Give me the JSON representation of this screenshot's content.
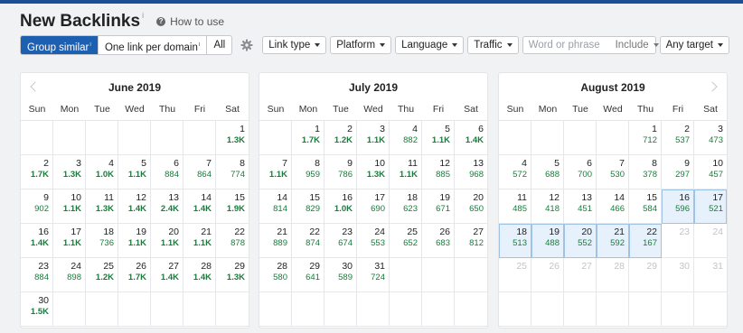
{
  "header": {
    "title": "New Backlinks",
    "title_sup": "i",
    "help_label": "How to use",
    "help_icon": "question-circle-icon"
  },
  "toolbar": {
    "group_similar": "Group similar",
    "one_link": "One link per domain",
    "all": "All",
    "settings_icon": "gear-icon",
    "link_type": "Link type",
    "platform": "Platform",
    "language": "Language",
    "traffic": "Traffic",
    "search_placeholder": "Word or phrase",
    "include": "Include",
    "any_target": "Any target"
  },
  "weekdays": [
    "Sun",
    "Mon",
    "Tue",
    "Wed",
    "Thu",
    "Fri",
    "Sat"
  ],
  "colors": {
    "accent": "#1d5fb0",
    "value_green": "#1c7a3c",
    "selected_bg": "#e7f1fb"
  },
  "calendars": [
    {
      "title": "June 2019",
      "cells": [
        {
          "d": "",
          "v": ""
        },
        {
          "d": "",
          "v": ""
        },
        {
          "d": "",
          "v": ""
        },
        {
          "d": "",
          "v": ""
        },
        {
          "d": "",
          "v": ""
        },
        {
          "d": "",
          "v": ""
        },
        {
          "d": "1",
          "v": "1.3K"
        },
        {
          "d": "2",
          "v": "1.7K"
        },
        {
          "d": "3",
          "v": "1.3K"
        },
        {
          "d": "4",
          "v": "1.0K"
        },
        {
          "d": "5",
          "v": "1.1K"
        },
        {
          "d": "6",
          "v": "884"
        },
        {
          "d": "7",
          "v": "864"
        },
        {
          "d": "8",
          "v": "774"
        },
        {
          "d": "9",
          "v": "902"
        },
        {
          "d": "10",
          "v": "1.1K"
        },
        {
          "d": "11",
          "v": "1.3K"
        },
        {
          "d": "12",
          "v": "1.4K"
        },
        {
          "d": "13",
          "v": "2.4K"
        },
        {
          "d": "14",
          "v": "1.4K"
        },
        {
          "d": "15",
          "v": "1.9K"
        },
        {
          "d": "16",
          "v": "1.4K"
        },
        {
          "d": "17",
          "v": "1.1K"
        },
        {
          "d": "18",
          "v": "736"
        },
        {
          "d": "19",
          "v": "1.1K"
        },
        {
          "d": "20",
          "v": "1.1K"
        },
        {
          "d": "21",
          "v": "1.1K"
        },
        {
          "d": "22",
          "v": "878"
        },
        {
          "d": "23",
          "v": "884"
        },
        {
          "d": "24",
          "v": "898"
        },
        {
          "d": "25",
          "v": "1.2K"
        },
        {
          "d": "26",
          "v": "1.7K"
        },
        {
          "d": "27",
          "v": "1.4K"
        },
        {
          "d": "28",
          "v": "1.4K"
        },
        {
          "d": "29",
          "v": "1.3K"
        },
        {
          "d": "30",
          "v": "1.5K"
        },
        {
          "d": "",
          "v": ""
        },
        {
          "d": "",
          "v": ""
        },
        {
          "d": "",
          "v": ""
        },
        {
          "d": "",
          "v": ""
        },
        {
          "d": "",
          "v": ""
        },
        {
          "d": "",
          "v": ""
        }
      ]
    },
    {
      "title": "July 2019",
      "cells": [
        {
          "d": "",
          "v": ""
        },
        {
          "d": "1",
          "v": "1.7K"
        },
        {
          "d": "2",
          "v": "1.2K"
        },
        {
          "d": "3",
          "v": "1.1K"
        },
        {
          "d": "4",
          "v": "882"
        },
        {
          "d": "5",
          "v": "1.1K"
        },
        {
          "d": "6",
          "v": "1.4K"
        },
        {
          "d": "7",
          "v": "1.1K"
        },
        {
          "d": "8",
          "v": "959"
        },
        {
          "d": "9",
          "v": "786"
        },
        {
          "d": "10",
          "v": "1.3K"
        },
        {
          "d": "11",
          "v": "1.1K"
        },
        {
          "d": "12",
          "v": "885"
        },
        {
          "d": "13",
          "v": "968"
        },
        {
          "d": "14",
          "v": "814"
        },
        {
          "d": "15",
          "v": "829"
        },
        {
          "d": "16",
          "v": "1.0K"
        },
        {
          "d": "17",
          "v": "690"
        },
        {
          "d": "18",
          "v": "623"
        },
        {
          "d": "19",
          "v": "671"
        },
        {
          "d": "20",
          "v": "650"
        },
        {
          "d": "21",
          "v": "889"
        },
        {
          "d": "22",
          "v": "874"
        },
        {
          "d": "23",
          "v": "674"
        },
        {
          "d": "24",
          "v": "553"
        },
        {
          "d": "25",
          "v": "652"
        },
        {
          "d": "26",
          "v": "683"
        },
        {
          "d": "27",
          "v": "812"
        },
        {
          "d": "28",
          "v": "580"
        },
        {
          "d": "29",
          "v": "641"
        },
        {
          "d": "30",
          "v": "589"
        },
        {
          "d": "31",
          "v": "724"
        },
        {
          "d": "",
          "v": ""
        },
        {
          "d": "",
          "v": ""
        },
        {
          "d": "",
          "v": ""
        },
        {
          "d": "",
          "v": ""
        },
        {
          "d": "",
          "v": ""
        },
        {
          "d": "",
          "v": ""
        },
        {
          "d": "",
          "v": ""
        },
        {
          "d": "",
          "v": ""
        },
        {
          "d": "",
          "v": ""
        },
        {
          "d": "",
          "v": ""
        }
      ]
    },
    {
      "title": "August 2019",
      "cells": [
        {
          "d": "",
          "v": ""
        },
        {
          "d": "",
          "v": ""
        },
        {
          "d": "",
          "v": ""
        },
        {
          "d": "",
          "v": ""
        },
        {
          "d": "1",
          "v": "712"
        },
        {
          "d": "2",
          "v": "537"
        },
        {
          "d": "3",
          "v": "473"
        },
        {
          "d": "4",
          "v": "572"
        },
        {
          "d": "5",
          "v": "688"
        },
        {
          "d": "6",
          "v": "700"
        },
        {
          "d": "7",
          "v": "530"
        },
        {
          "d": "8",
          "v": "378"
        },
        {
          "d": "9",
          "v": "297"
        },
        {
          "d": "10",
          "v": "457"
        },
        {
          "d": "11",
          "v": "485"
        },
        {
          "d": "12",
          "v": "418"
        },
        {
          "d": "13",
          "v": "451"
        },
        {
          "d": "14",
          "v": "466"
        },
        {
          "d": "15",
          "v": "584"
        },
        {
          "d": "16",
          "v": "596",
          "sel": true
        },
        {
          "d": "17",
          "v": "521",
          "sel": true
        },
        {
          "d": "18",
          "v": "513",
          "sel": true
        },
        {
          "d": "19",
          "v": "488",
          "sel": true
        },
        {
          "d": "20",
          "v": "552",
          "sel": true
        },
        {
          "d": "21",
          "v": "592",
          "sel": true
        },
        {
          "d": "22",
          "v": "167",
          "sel": true
        },
        {
          "d": "23",
          "v": "",
          "muted": true
        },
        {
          "d": "24",
          "v": "",
          "muted": true
        },
        {
          "d": "25",
          "v": "",
          "muted": true
        },
        {
          "d": "26",
          "v": "",
          "muted": true
        },
        {
          "d": "27",
          "v": "",
          "muted": true
        },
        {
          "d": "28",
          "v": "",
          "muted": true
        },
        {
          "d": "29",
          "v": "",
          "muted": true
        },
        {
          "d": "30",
          "v": "",
          "muted": true
        },
        {
          "d": "31",
          "v": "",
          "muted": true
        },
        {
          "d": "",
          "v": ""
        },
        {
          "d": "",
          "v": ""
        },
        {
          "d": "",
          "v": ""
        },
        {
          "d": "",
          "v": ""
        },
        {
          "d": "",
          "v": ""
        },
        {
          "d": "",
          "v": ""
        },
        {
          "d": "",
          "v": ""
        }
      ]
    }
  ]
}
